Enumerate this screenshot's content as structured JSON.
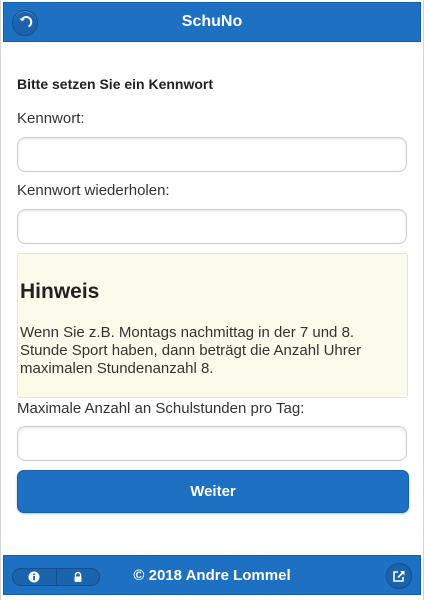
{
  "app": {
    "title": "SchuNo"
  },
  "header": {
    "back_icon": "back-arrow-icon"
  },
  "form": {
    "heading": "Bitte setzen Sie ein Kennwort",
    "password_label": "Kennwort:",
    "password_value": "",
    "password_repeat_label": "Kennwort wiederholen:",
    "password_repeat_value": "",
    "max_lessons_label": "Maximale Anzahl an Schulstunden pro Tag:",
    "max_lessons_value": "",
    "submit_label": "Weiter"
  },
  "hint": {
    "title": "Hinweis",
    "text": "Wenn Sie z.B. Montags nachmittag in der 7 und 8. Stunde Sport haben, dann beträgt die Anzahl Uhrer maximalen Stundenanzahl 8."
  },
  "footer": {
    "copyright": "© 2018 Andre Lommel",
    "icons": [
      "info-icon",
      "lock-icon",
      "share-icon"
    ]
  },
  "colors": {
    "accent": "#1e70c2",
    "hint_bg": "#fbfbec"
  }
}
